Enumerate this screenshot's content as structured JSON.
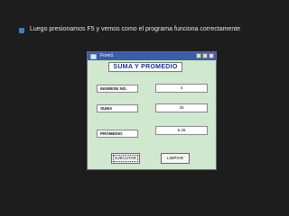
{
  "slide": {
    "caption": "Luego presionamos F5 y vemos como el programa funciona correctamente"
  },
  "window": {
    "title": "Form1",
    "banner": "SUMA Y PROMEDIO",
    "fields": [
      {
        "label": "INGRESE  NO.",
        "value": "4"
      },
      {
        "label": "SUMA",
        "value": "25"
      },
      {
        "label": "PROMEDIO",
        "value": "6.25"
      }
    ],
    "buttons": {
      "execute": "EJECUTAR",
      "clear": "LIMPIAR"
    }
  }
}
